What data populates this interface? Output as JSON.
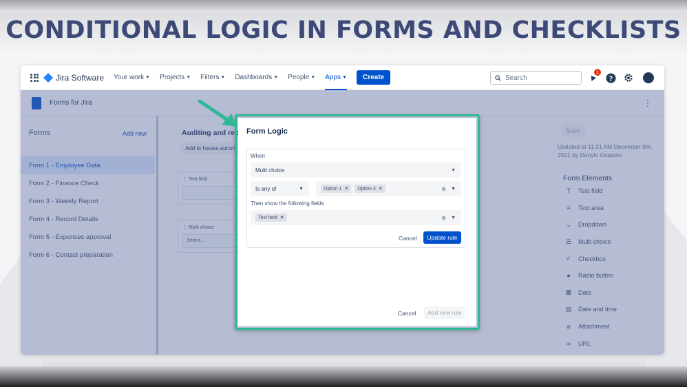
{
  "headline": "CONDITIONAL LOGIC IN FORMS AND CHECKLISTS",
  "topnav": {
    "brand": "Jira Software",
    "items": [
      {
        "label": "Your work"
      },
      {
        "label": "Projects"
      },
      {
        "label": "Filters"
      },
      {
        "label": "Dashboards"
      },
      {
        "label": "People"
      },
      {
        "label": "Apps"
      }
    ],
    "create_label": "Create",
    "search_placeholder": "Search",
    "notification_count": "1"
  },
  "subheader": {
    "title": "Forms for Jira"
  },
  "sidebar": {
    "title": "Forms",
    "add_label": "Add new",
    "forms": [
      {
        "label": "Form 1 - Employee Data"
      },
      {
        "label": "Form 2 - Finance Check"
      },
      {
        "label": "Form 3 - Weekly Report"
      },
      {
        "label": "Form 4 - Record Details"
      },
      {
        "label": "Form 5 - Expenses approval"
      },
      {
        "label": "Form 6 - Contact preparation"
      }
    ]
  },
  "center": {
    "title": "Auditing and repo",
    "button": "Add to Issues autom",
    "field1_label": "Text field",
    "field2_label": "Multi choice",
    "field2_placeholder": "Select..."
  },
  "right_panel": {
    "save_label": "Save",
    "updated": "Updated at 11:31 AM December 9th, 2021 by Danylo Ostapov",
    "elements_title": "Form Elements",
    "elements": [
      {
        "label": "Text field",
        "icon": "T"
      },
      {
        "label": "Text area",
        "icon": "≡"
      },
      {
        "label": "Dropdown",
        "icon": "⌄"
      },
      {
        "label": "Multi choice",
        "icon": "☰"
      },
      {
        "label": "Checkbox",
        "icon": "✓"
      },
      {
        "label": "Radio button",
        "icon": "●"
      },
      {
        "label": "Date",
        "icon": "▦"
      },
      {
        "label": "Date and time",
        "icon": "▤"
      },
      {
        "label": "Attachment",
        "icon": "⌀"
      },
      {
        "label": "URL",
        "icon": "∞"
      }
    ]
  },
  "modal": {
    "title": "Form Logic",
    "when_label": "When",
    "when_value": "Multi choice",
    "operator": "Is any of",
    "options": [
      "Option 1",
      "Option 3"
    ],
    "then_label": "Then show the following fields",
    "then_fields": [
      "Text field"
    ],
    "cancel_rule": "Cancel",
    "update_rule": "Update rule",
    "cancel": "Cancel",
    "add_new_rule": "Add new rule"
  },
  "colors": {
    "headline": "#3d4a78",
    "primary": "#0052cc",
    "highlight_frame": "#2fb896",
    "overlay": "#4e6096"
  }
}
